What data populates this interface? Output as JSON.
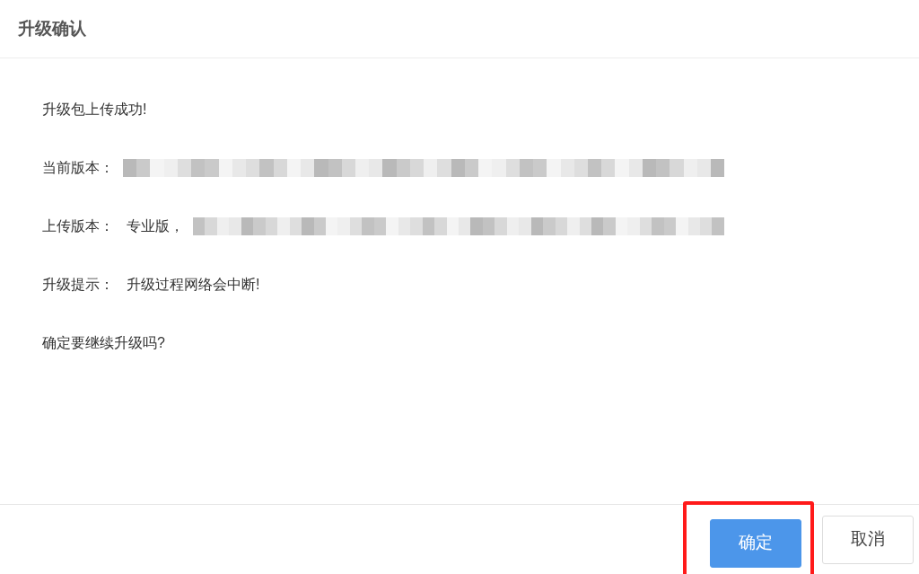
{
  "dialog": {
    "title": "升级确认"
  },
  "lines": [
    {
      "label": "升级包上传成功!"
    },
    {
      "label": "当前版本：",
      "redacted": true
    },
    {
      "label": "上传版本：",
      "value": "专业版，",
      "redacted": true
    },
    {
      "label": "升级提示：",
      "value": "升级过程网络会中断!"
    },
    {
      "label": "确定要继续升级吗?"
    }
  ],
  "buttons": [
    {
      "label": "确定",
      "kind": "primary",
      "highlighted": true
    },
    {
      "label": "取消",
      "kind": "default",
      "highlighted": false
    }
  ]
}
